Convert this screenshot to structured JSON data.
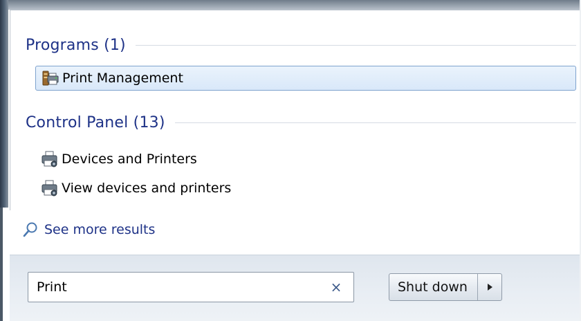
{
  "groups": {
    "programs": {
      "title": "Programs (1)",
      "items": [
        {
          "label": "Print Management",
          "icon": "print-management-icon",
          "selected": true
        }
      ]
    },
    "control_panel": {
      "title": "Control Panel (13)",
      "items": [
        {
          "label": "Devices and Printers",
          "icon": "printer-icon"
        },
        {
          "label": "View devices and printers",
          "icon": "printer-icon"
        }
      ]
    }
  },
  "see_more": {
    "label": "See more results",
    "icon": "search-icon"
  },
  "search": {
    "value": "Print",
    "clear_glyph": "×"
  },
  "shutdown": {
    "label": "Shut down",
    "arrow_icon": "arrow-right-icon"
  },
  "colors": {
    "group_title": "#1e3287",
    "selection_border": "#7da2ce",
    "selection_fill": "#dbe9f9"
  }
}
